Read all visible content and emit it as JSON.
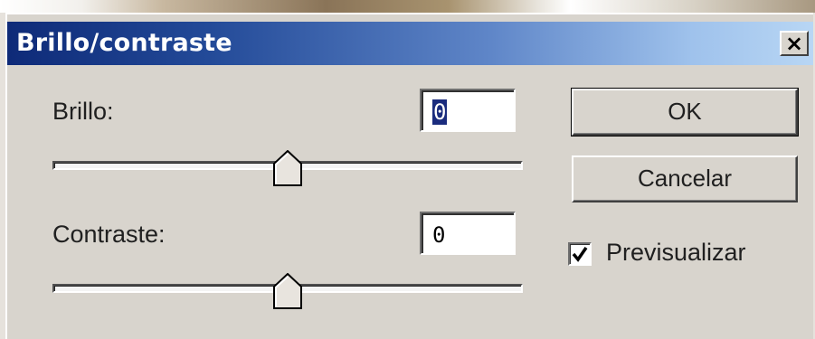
{
  "dialog": {
    "title": "Brillo/contraste",
    "close_label": "×"
  },
  "brightness": {
    "label": "Brillo:",
    "value": "0",
    "slider_position": 0.5
  },
  "contrast": {
    "label": "Contraste:",
    "value": "0",
    "slider_position": 0.5
  },
  "buttons": {
    "ok_label": "OK",
    "cancel_label": "Cancelar"
  },
  "preview": {
    "label": "Previsualizar",
    "checked": true
  }
}
